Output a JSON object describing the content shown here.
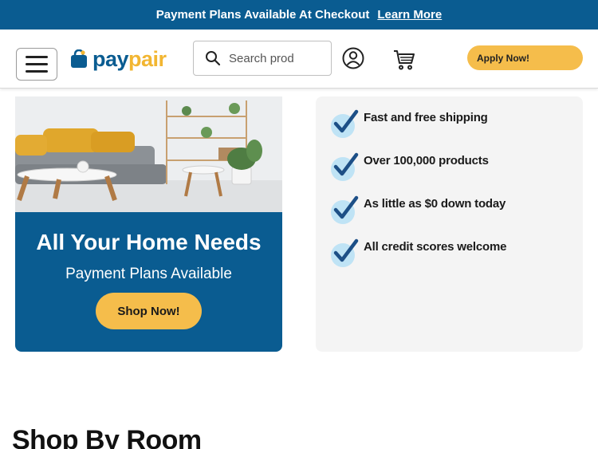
{
  "promo": {
    "text": "Payment Plans Available At Checkout",
    "link": "Learn More"
  },
  "header": {
    "logo_pay": "pay",
    "logo_pair": "pair",
    "search_placeholder": "Search prod",
    "apply_label": "Apply Now!",
    "icons": [
      "menu-icon",
      "search-icon",
      "user-icon",
      "cart-icon"
    ]
  },
  "hero": {
    "title": "All Your Home Needs",
    "subtitle": "Payment Plans Available",
    "button": "Shop Now!"
  },
  "benefits": [
    {
      "label": "Fast and free shipping"
    },
    {
      "label": "Over 100,000 products"
    },
    {
      "label": "As little as $0 down today"
    },
    {
      "label": "All credit scores welcome"
    }
  ],
  "sections": {
    "shop_by_room": "Shop By Room"
  },
  "colors": {
    "brand_blue": "#0a5c91",
    "accent_yellow": "#f5bd4b",
    "check_bg": "#bfe3f5",
    "check_mark": "#1d4f86"
  }
}
